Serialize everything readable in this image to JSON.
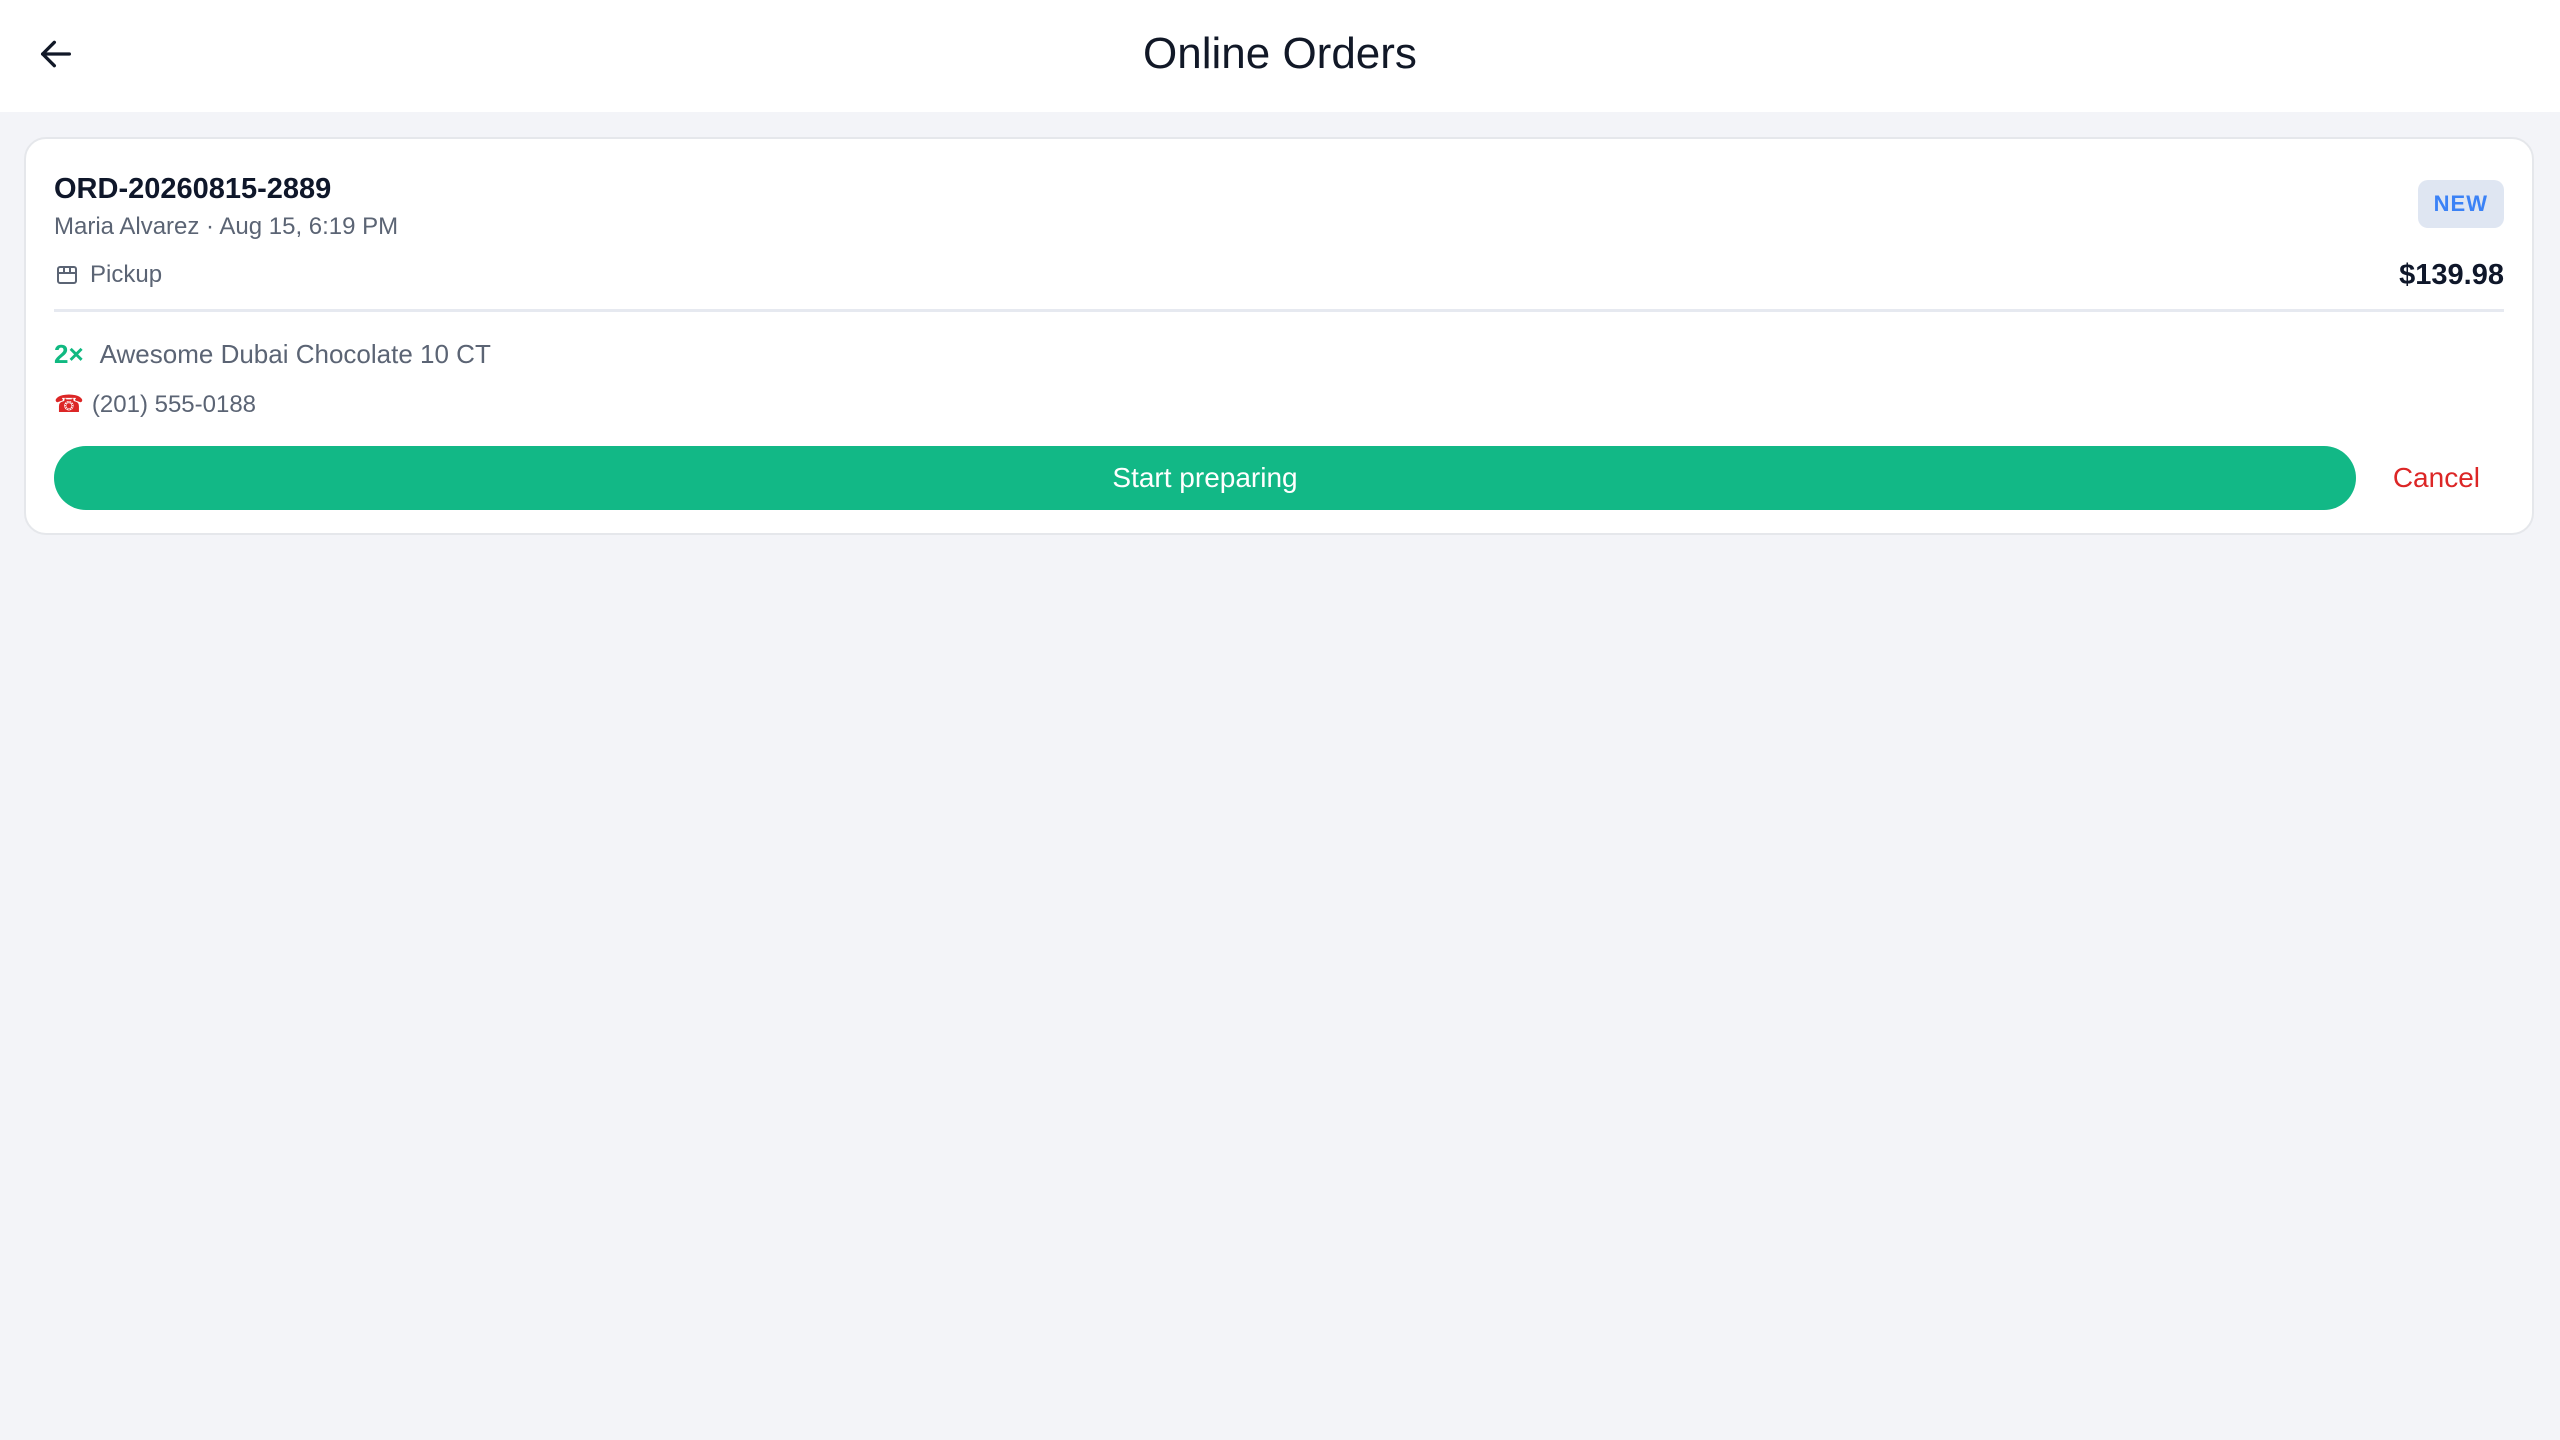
{
  "header": {
    "back_icon": "arrow-left-icon",
    "title": "Online Orders"
  },
  "order": {
    "id": "ORD-20260815-2889",
    "meta": "Maria Alvarez · Aug 15, 6:19 PM",
    "status": "NEW",
    "fulfillment": {
      "icon": "store-icon",
      "label": "Pickup"
    },
    "total": "$139.98",
    "items": [
      {
        "qty": "2×",
        "name": "Awesome Dubai Chocolate 10 CT"
      }
    ],
    "phone": {
      "icon": "telephone-icon",
      "number": "(201) 555-0188"
    },
    "actions": {
      "primary_label": "Start preparing",
      "cancel_label": "Cancel"
    }
  },
  "colors": {
    "accent_green": "#12b886",
    "cancel_red": "#dc2626",
    "badge_bg": "#dfe6f2",
    "badge_text": "#3b82f6",
    "page_bg": "#f3f4f8"
  }
}
